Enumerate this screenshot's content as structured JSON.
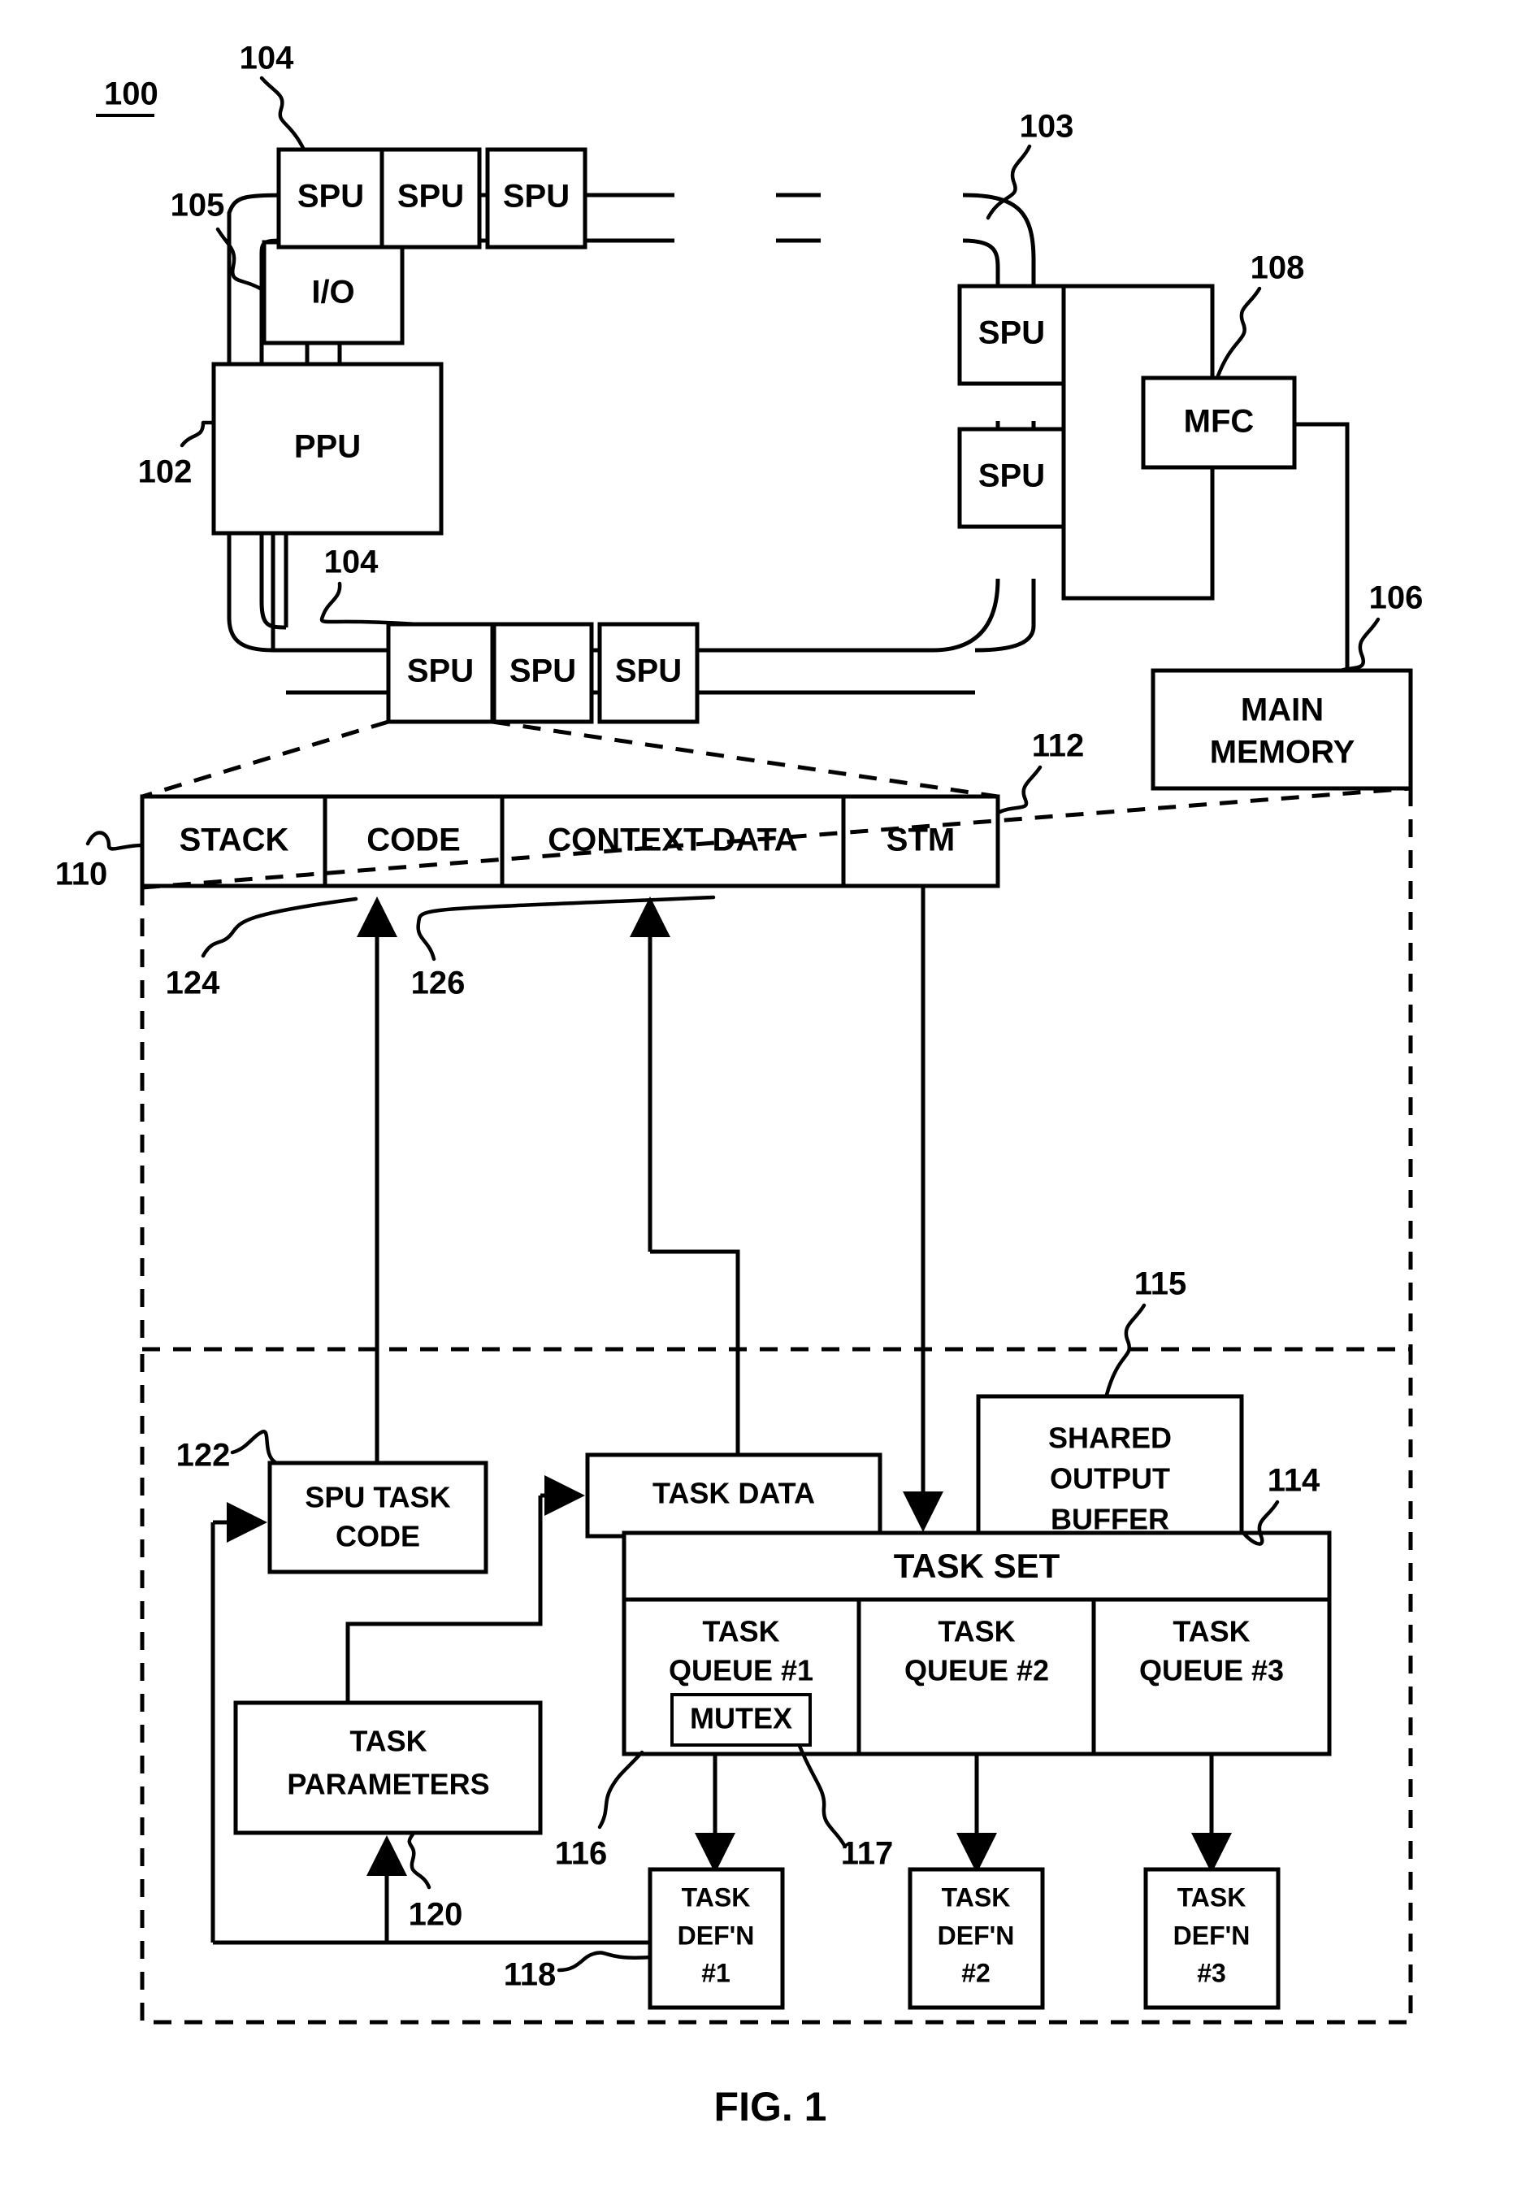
{
  "figure": {
    "caption": "FIG. 1",
    "system_ref": "100"
  },
  "processor": {
    "ppu": {
      "label": "PPU",
      "ref": "102"
    },
    "io": {
      "label": "I/O",
      "ref": "105"
    },
    "bus": {
      "ref": "103"
    },
    "spu_ref": "104",
    "spus": [
      {
        "label": "SPU"
      },
      {
        "label": "SPU"
      },
      {
        "label": "SPU"
      },
      {
        "label": "SPU"
      },
      {
        "label": "SPU"
      },
      {
        "label": "SPU"
      },
      {
        "label": "SPU"
      },
      {
        "label": "SPU"
      }
    ],
    "mfc": {
      "label": "MFC",
      "ref": "108"
    },
    "main_memory": {
      "label_line1": "MAIN",
      "label_line2": "MEMORY",
      "ref": "106"
    }
  },
  "local_store": {
    "ref": "110",
    "stm_ref": "112",
    "code_ref": "124",
    "context_ref": "126",
    "segments": [
      {
        "label": "STACK"
      },
      {
        "label": "CODE"
      },
      {
        "label": "CONTEXT DATA"
      },
      {
        "label": "STM"
      }
    ]
  },
  "memory_detail": {
    "spu_task_code": {
      "line1": "SPU TASK",
      "line2": "CODE",
      "ref": "122"
    },
    "task_data": {
      "label": "TASK DATA"
    },
    "task_parameters": {
      "line1": "TASK",
      "line2": "PARAMETERS",
      "ref": "120"
    },
    "shared_output_buffer": {
      "line1": "SHARED",
      "line2": "OUTPUT",
      "line3": "BUFFER",
      "ref": "115"
    },
    "task_set": {
      "label": "TASK SET",
      "ref": "114"
    },
    "queue_ref": "116",
    "mutex_ref": "117",
    "task_defn_ref": "118",
    "queues": [
      {
        "line1": "TASK",
        "line2": "QUEUE #1",
        "mutex": "MUTEX"
      },
      {
        "line1": "TASK",
        "line2": "QUEUE #2",
        "mutex": null
      },
      {
        "line1": "TASK",
        "line2": "QUEUE #3",
        "mutex": null
      }
    ],
    "task_definitions": [
      {
        "line1": "TASK",
        "line2": "DEF'N",
        "line3": "#1"
      },
      {
        "line1": "TASK",
        "line2": "DEF'N",
        "line3": "#2"
      },
      {
        "line1": "TASK",
        "line2": "DEF'N",
        "line3": "#3"
      }
    ]
  }
}
